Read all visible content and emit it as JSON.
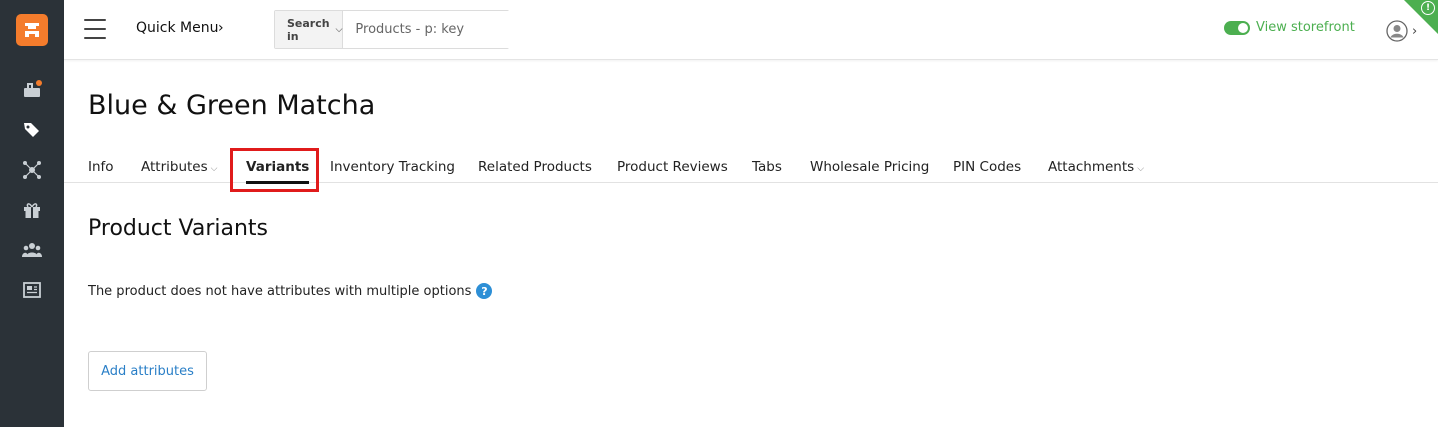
{
  "sidebar": {
    "brand_color": "#f47c2c",
    "background": "#2b3238",
    "items": [
      {
        "icon": "orders-icon",
        "has_notification": true
      },
      {
        "icon": "tags-icon"
      },
      {
        "icon": "hub-icon"
      },
      {
        "icon": "gift-icon"
      },
      {
        "icon": "users-icon"
      },
      {
        "icon": "newspaper-icon"
      }
    ]
  },
  "header": {
    "quick_menu_label": "Quick Menu",
    "quick_menu_chevron": "›",
    "search_in_label": "Search in",
    "search_placeholder": "Products - p: key",
    "storefront_label": "View storefront",
    "storefront_color": "#4caf50",
    "user_chevron": "›",
    "corner_mark": "!"
  },
  "page": {
    "title": "Blue & Green Matcha"
  },
  "tabs": [
    {
      "label": "Info"
    },
    {
      "label": "Attributes",
      "dropdown": true
    },
    {
      "label": "Variants",
      "active": true
    },
    {
      "label": "Inventory Tracking"
    },
    {
      "label": "Related Products"
    },
    {
      "label": "Product Reviews"
    },
    {
      "label": "Tabs"
    },
    {
      "label": "Wholesale Pricing"
    },
    {
      "label": "PIN Codes"
    },
    {
      "label": "Attachments",
      "dropdown": true
    }
  ],
  "main": {
    "section_title": "Product Variants",
    "notice_text": "The product does not have attributes with multiple options",
    "help_glyph": "?",
    "add_button_label": "Add attributes"
  },
  "colors": {
    "highlight_border": "#e01b1b",
    "link_blue": "#2a7fc7",
    "help_blue": "#2d8fd6"
  }
}
